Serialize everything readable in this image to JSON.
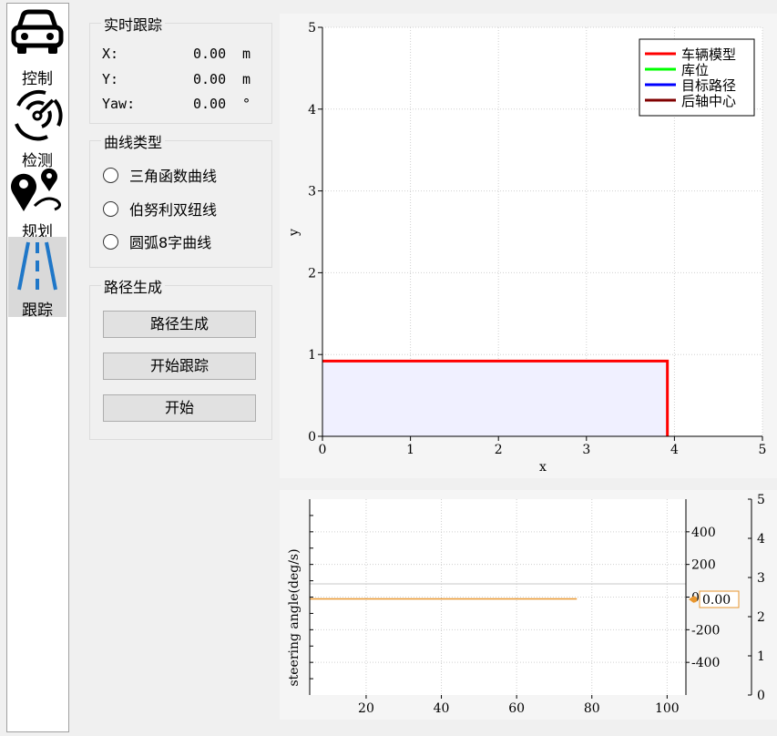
{
  "sidebar": {
    "items": [
      {
        "label": "控制",
        "icon": "car-icon"
      },
      {
        "label": "检测",
        "icon": "radar-icon"
      },
      {
        "label": "规划",
        "icon": "map-pin-route-icon"
      },
      {
        "label": "跟踪",
        "icon": "lane-road-icon",
        "active": true
      }
    ]
  },
  "realtime": {
    "title": "实时跟踪",
    "x_label": "X:",
    "x_value": "0.00",
    "x_unit": "m",
    "y_label": "Y:",
    "y_value": "0.00",
    "y_unit": "m",
    "yaw_label": "Yaw:",
    "yaw_value": "0.00",
    "yaw_unit": "°"
  },
  "curve_type": {
    "title": "曲线类型",
    "options": [
      "三角函数曲线",
      "伯努利双纽线",
      "圆弧8字曲线"
    ]
  },
  "path_gen": {
    "title": "路径生成",
    "buttons": [
      "路径生成",
      "开始跟踪",
      "开始"
    ]
  },
  "colors": {
    "vehicle": "#ff0000",
    "parking": "#00ff00",
    "target_path": "#0000ff",
    "rear_axle": "#800000",
    "steering": "#e8962e",
    "fill": "#f0f0ff"
  },
  "chart_data": [
    {
      "type": "line",
      "xlabel": "x",
      "ylabel": "y",
      "xlim": [
        0,
        5
      ],
      "ylim": [
        0,
        5
      ],
      "xticks": [
        "0",
        "1",
        "2",
        "3",
        "4",
        "5"
      ],
      "yticks": [
        "0",
        "1",
        "2",
        "3",
        "4",
        "5"
      ],
      "grid": true,
      "legend_position": "top-right",
      "series": [
        {
          "name": "车辆模型",
          "color": "#ff0000",
          "x": [
            0,
            3.92,
            3.92
          ],
          "y": [
            0.92,
            0.92,
            0
          ]
        },
        {
          "name": "库位",
          "color": "#00ff00",
          "x": [],
          "y": []
        },
        {
          "name": "目标路径",
          "color": "#0000ff",
          "x": [],
          "y": []
        },
        {
          "name": "后轴中心",
          "color": "#800000",
          "x": [],
          "y": []
        }
      ]
    },
    {
      "type": "line",
      "xlabel": "",
      "ylabel": "steering angle(deg/s)",
      "xlim": [
        5,
        105
      ],
      "ylim": [
        -600,
        600
      ],
      "right_ylim": [
        0,
        5
      ],
      "xticks": [
        "20",
        "40",
        "60",
        "80",
        "100"
      ],
      "yticks": [
        "400",
        "200",
        "0",
        "-200",
        "-400"
      ],
      "right_yticks": [
        "5",
        "4",
        "3",
        "2",
        "1",
        "0"
      ],
      "grid": true,
      "current_value": "0.00",
      "series": [
        {
          "color": "#e8962e",
          "x": [
            5,
            76
          ],
          "y": [
            0,
            0
          ]
        }
      ]
    }
  ]
}
